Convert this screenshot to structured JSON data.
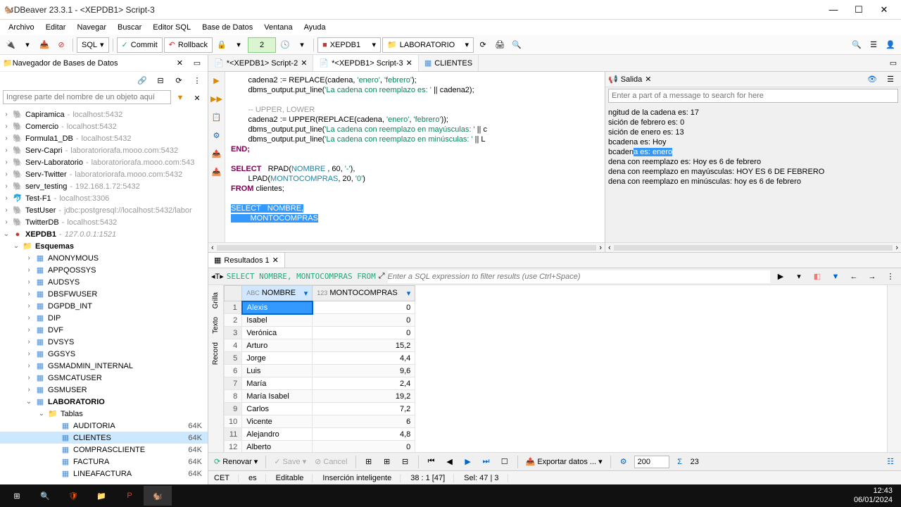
{
  "window": {
    "title": "DBeaver 23.3.1 - <XEPDB1> Script-3"
  },
  "menu": [
    "Archivo",
    "Editar",
    "Navegar",
    "Buscar",
    "Editor SQL",
    "Base de Datos",
    "Ventana",
    "Ayuda"
  ],
  "toolbar": {
    "sql_label": "SQL",
    "commit": "Commit",
    "rollback": "Rollback",
    "txn_count": "2",
    "conn1": "XEPDB1",
    "conn2": "LABORATORIO"
  },
  "sidebar": {
    "title": "Navegador de Bases de Datos",
    "search_placeholder": "Ingrese parte del nombre de un objeto aquí",
    "connections": [
      {
        "name": "Capiramica",
        "host": "localhost:5432"
      },
      {
        "name": "Comercio",
        "host": "localhost:5432"
      },
      {
        "name": "Formula1_DB",
        "host": "localhost:5432"
      },
      {
        "name": "Serv-Capri",
        "host": "laboratoriorafa.mooo.com:5432"
      },
      {
        "name": "Serv-Laboratorio",
        "host": "laboratoriorafa.mooo.com:543"
      },
      {
        "name": "Serv-Twitter",
        "host": "laboratoriorafa.mooo.com:5432"
      },
      {
        "name": "serv_testing",
        "host": "192.168.1.72:5432"
      },
      {
        "name": "Test-F1",
        "host": "localhost:3306"
      },
      {
        "name": "TestUser",
        "host": "jdbc:postgresql://localhost:5432/labor"
      },
      {
        "name": "TwitterDB",
        "host": "localhost:5432"
      },
      {
        "name": "XEPDB1",
        "host": "127.0.0.1:1521"
      }
    ],
    "esquemas_label": "Esquemas",
    "schemas": [
      "ANONYMOUS",
      "APPQOSSYS",
      "AUDSYS",
      "DBSFWUSER",
      "DGPDB_INT",
      "DIP",
      "DVF",
      "DVSYS",
      "GGSYS",
      "GSMADMIN_INTERNAL",
      "GSMCATUSER",
      "GSMUSER"
    ],
    "lab_schema": "LABORATORIO",
    "tablas_label": "Tablas",
    "tables": [
      {
        "name": "AUDITORIA",
        "size": "64K"
      },
      {
        "name": "CLIENTES",
        "size": "64K"
      },
      {
        "name": "COMPRASCLIENTE",
        "size": "64K"
      },
      {
        "name": "FACTURA",
        "size": "64K"
      },
      {
        "name": "LINEAFACTURA",
        "size": "64K"
      }
    ]
  },
  "editor_tabs": [
    {
      "label": "*<XEPDB1> Script-2",
      "active": false
    },
    {
      "label": "*<XEPDB1> Script-3",
      "active": true
    },
    {
      "label": "CLIENTES",
      "active": false
    }
  ],
  "code": {
    "l1_pre": "        cadena2 := REPLACE(cadena, ",
    "l1_s1": "'enero'",
    "l1_mid": ", ",
    "l1_s2": "'febrero'",
    "l1_post": ");",
    "l2_pre": "        dbms_output.put_line(",
    "l2_s": "'La cadena con reemplazo es: '",
    "l2_post": " || cadena2);",
    "l3": "",
    "l4": "        -- UPPER, LOWER",
    "l5_pre": "        cadena2 := UPPER(REPLACE(cadena, ",
    "l5_s1": "'enero'",
    "l5_mid": ", ",
    "l5_s2": "'febrero'",
    "l5_post": "));",
    "l6_pre": "        dbms_output.put_line(",
    "l6_s": "'La cadena con reemplazo en mayúsculas: '",
    "l6_post": " || c",
    "l7_pre": "        dbms_output.put_line(",
    "l7_s": "'La cadena con reemplazo en minúsculas: '",
    "l7_post": " || L",
    "l8": "END;",
    "l9": "",
    "l10_kw": "SELECT",
    "l10_rest": "   RPAD(",
    "l10_id": "NOMBRE",
    "l10_post": " , 60, ",
    "l10_s": "'-'",
    "l10_end": "),",
    "l11_pre": "        LPAD(",
    "l11_id": "MONTOCOMPRAS",
    "l11_mid": ", 20, ",
    "l11_s": "'0'",
    "l11_end": ")",
    "l12_kw": "FROM",
    "l12_rest": " clientes;",
    "l13": "",
    "l14_sel": "SELECT   NOMBRE,",
    "l15_sel": "         MONTOCOMPRAS"
  },
  "output": {
    "title": "Salida",
    "search_placeholder": "Enter a part of a message to search for here",
    "lines": [
      "ngitud de la cadena es: 17",
      "sición de febrero es: 0",
      "sición de enero es: 13",
      "bcadena es: Hoy"
    ],
    "hl_pre": "bcaden",
    "hl_sel": "a es: enero",
    "lines2": [
      "dena con reemplazo es: Hoy es 6 de febrero",
      "dena con reemplazo en mayúsculas: HOY ES 6 DE FEBRERO",
      "dena con reemplazo en minúsculas: hoy es 6 de febrero"
    ]
  },
  "results": {
    "tab": "Resultados 1",
    "sql": "SELECT NOMBRE, MONTOCOMPRAS FROM",
    "filter_placeholder": "Enter a SQL expression to filter results (use Ctrl+Space)",
    "cols": {
      "c1_prefix": "ABC",
      "c1": "NOMBRE",
      "c2_prefix": "123",
      "c2": "MONTOCOMPRAS"
    },
    "rows": [
      {
        "n": 1,
        "nombre": "Alexis",
        "monto": "0"
      },
      {
        "n": 2,
        "nombre": "Isabel",
        "monto": "0"
      },
      {
        "n": 3,
        "nombre": "Verónica",
        "monto": "0"
      },
      {
        "n": 4,
        "nombre": "Arturo",
        "monto": "15,2"
      },
      {
        "n": 5,
        "nombre": "Jorge",
        "monto": "4,4"
      },
      {
        "n": 6,
        "nombre": "Luis",
        "monto": "9,6"
      },
      {
        "n": 7,
        "nombre": "María",
        "monto": "2,4"
      },
      {
        "n": 8,
        "nombre": "María Isabel",
        "monto": "19,2"
      },
      {
        "n": 9,
        "nombre": "Carlos",
        "monto": "7,2"
      },
      {
        "n": 10,
        "nombre": "Vicente",
        "monto": "6"
      },
      {
        "n": 11,
        "nombre": "Alejandro",
        "monto": "4,8"
      },
      {
        "n": 12,
        "nombre": "Alberto",
        "monto": "0"
      }
    ],
    "vtabs": {
      "grilla": "Grilla",
      "texto": "Texto",
      "record": "Record"
    },
    "btns": {
      "renovar": "Renovar",
      "save": "Save",
      "cancel": "Cancel",
      "export": "Exportar datos ...",
      "page_size": "200",
      "total": "23"
    }
  },
  "status": {
    "tz": "CET",
    "lang": "es",
    "mode": "Editable",
    "insert": "Inserción inteligente",
    "pos": "38 : 1 [47]",
    "sel": "Sel: 47 | 3"
  },
  "taskbar": {
    "time": "12:43",
    "date": "06/01/2024"
  }
}
